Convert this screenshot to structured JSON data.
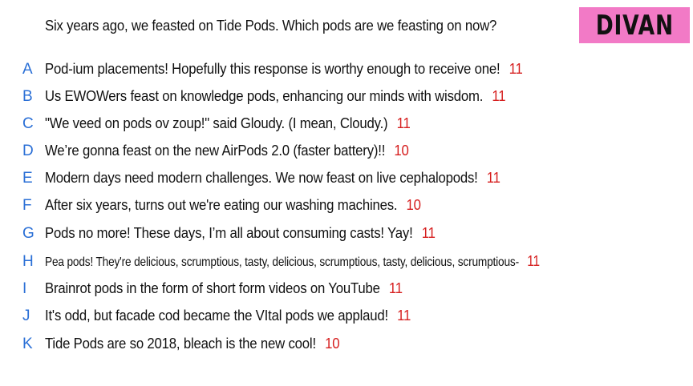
{
  "prompt": "Six years ago, we feasted on Tide Pods. Which pods are we feasting on now?",
  "name_badge": {
    "text": "DIVAN",
    "background": "#f27ac6"
  },
  "colors": {
    "letter": "#2a6fd6",
    "score": "#d61f1f",
    "text": "#111111"
  },
  "responses": [
    {
      "letter": "A",
      "text": "Pod-ium placements! Hopefully this response is worthy enough to receive one!",
      "score": "11"
    },
    {
      "letter": "B",
      "text": "Us EWOWers feast on knowledge pods, enhancing our minds with wisdom.",
      "score": "11"
    },
    {
      "letter": "C",
      "text": "\"We veed on pods ov zoup!\" said Gloudy. (I mean, Cloudy.)",
      "score": "11"
    },
    {
      "letter": "D",
      "text": "We’re gonna feast on the new AirPods 2.0 (faster battery)!!",
      "score": "10"
    },
    {
      "letter": "E",
      "text": "Modern days need modern challenges. We now feast on live cephalopods!",
      "score": "11"
    },
    {
      "letter": "F",
      "text": "After six years, turns out we're eating our washing machines.",
      "score": "10"
    },
    {
      "letter": "G",
      "text": "Pods no more! These days, I’m all about consuming casts! Yay!",
      "score": "11"
    },
    {
      "letter": "H",
      "text": "Pea pods! They're delicious, scrumptious, tasty, delicious, scrumptious, tasty, delicious, scrumptious-",
      "score": "11"
    },
    {
      "letter": "I",
      "text": "Brainrot pods in the form of short form videos on YouTube",
      "score": "11"
    },
    {
      "letter": "J",
      "text": "It's odd, but facade cod became the VItal pods we applaud!",
      "score": "11"
    },
    {
      "letter": "K",
      "text": "Tide Pods are so 2018, bleach is the new cool!",
      "score": "10"
    }
  ]
}
